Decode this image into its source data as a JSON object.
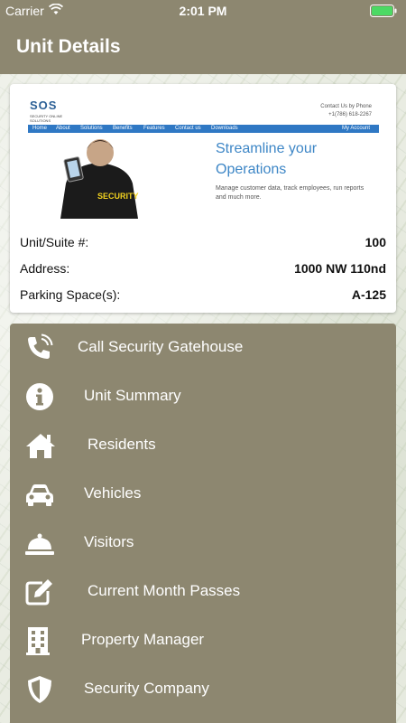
{
  "status_bar": {
    "carrier": "Carrier",
    "time": "2:01 PM"
  },
  "nav": {
    "title": "Unit Details"
  },
  "banner": {
    "logo": "SOS",
    "logo_subtitle": "SECURITY ONLINE SOLUTIONS",
    "contact_label": "Contact Us by Phone",
    "contact_phone": "+1(786) 618-2267",
    "nav_items": [
      "Home",
      "About",
      "Solutions",
      "Benefits",
      "Features",
      "Contact us",
      "Downloads"
    ],
    "account": "My Account",
    "vest_text": "SECURITY",
    "headline_1": "Streamline your",
    "headline_2": "Operations",
    "body": "Manage customer data, track employees, run reports and much more."
  },
  "unit": {
    "suite_label": "Unit/Suite #:",
    "suite_value": "100",
    "address_label": "Address:",
    "address_value": "1000 NW 110nd",
    "parking_label": "Parking Space(s):",
    "parking_value": "A-125"
  },
  "menu": {
    "items": [
      {
        "label": "Call Security Gatehouse",
        "icon": "phone-icon"
      },
      {
        "label": "Unit Summary",
        "icon": "info-icon"
      },
      {
        "label": "Residents",
        "icon": "home-icon"
      },
      {
        "label": "Vehicles",
        "icon": "car-icon"
      },
      {
        "label": "Visitors",
        "icon": "bell-icon"
      },
      {
        "label": "Current Month Passes",
        "icon": "edit-icon"
      },
      {
        "label": "Property Manager",
        "icon": "building-icon"
      },
      {
        "label": "Security Company",
        "icon": "shield-icon"
      }
    ]
  },
  "colors": {
    "bar": "#8d8770",
    "accent": "#2f78c4",
    "battery": "#4cd964"
  }
}
